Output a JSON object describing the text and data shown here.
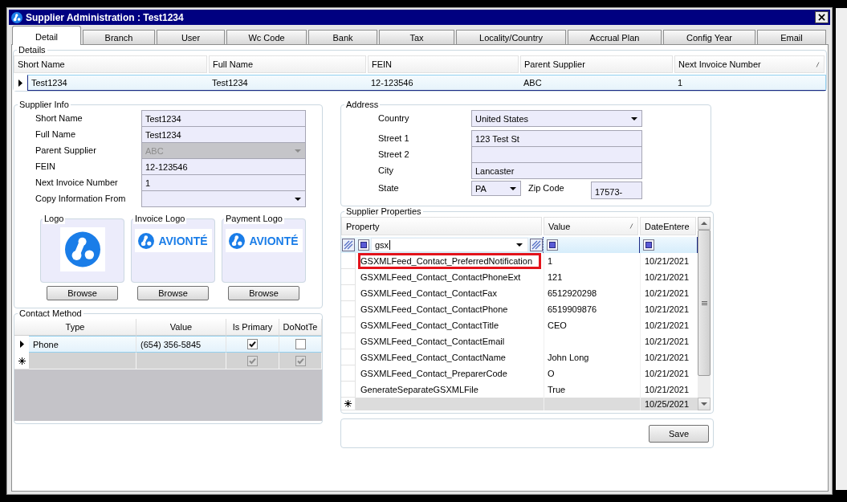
{
  "window": {
    "title": "Supplier Administration : Test1234"
  },
  "tabs": [
    {
      "label": "Detail",
      "selected": true
    },
    {
      "label": "Branch",
      "selected": false
    },
    {
      "label": "User",
      "selected": false
    },
    {
      "label": "Wc Code",
      "selected": false
    },
    {
      "label": "Bank",
      "selected": false
    },
    {
      "label": "Tax",
      "selected": false
    },
    {
      "label": "Locality/Country",
      "selected": false
    },
    {
      "label": "Accrual Plan",
      "selected": false
    },
    {
      "label": "Config Year",
      "selected": false
    },
    {
      "label": "Email",
      "selected": false
    }
  ],
  "details": {
    "title": "Details",
    "columns": [
      {
        "label": "Short Name",
        "sort_mark": false
      },
      {
        "label": "Full Name",
        "sort_mark": false
      },
      {
        "label": "FEIN",
        "sort_mark": false
      },
      {
        "label": "Parent Supplier",
        "sort_mark": false
      },
      {
        "label": "Next Invoice Number",
        "sort_mark": true
      }
    ],
    "rows": [
      {
        "current": true,
        "cells": [
          "Test1234",
          "Test1234",
          "12-123546",
          "ABC",
          "1"
        ]
      }
    ]
  },
  "supplier_info": {
    "title": "Supplier Info",
    "fields": [
      {
        "label": "Short Name",
        "kind": "text",
        "value": "Test1234",
        "disabled": false
      },
      {
        "label": "Full Name",
        "kind": "text",
        "value": "Test1234",
        "disabled": false
      },
      {
        "label": "Parent Supplier",
        "kind": "dropdown",
        "value": "ABC",
        "disabled": true
      },
      {
        "label": "FEIN",
        "kind": "text",
        "value": "12-123546",
        "disabled": false
      },
      {
        "label": "Next Invoice Number",
        "kind": "text",
        "value": "1",
        "disabled": false
      },
      {
        "label": "Copy Information From",
        "kind": "dropdown",
        "disabled": false
      }
    ],
    "logos": [
      {
        "title": "Logo",
        "kind": "mark",
        "button": "Browse"
      },
      {
        "title": "Invoice Logo",
        "kind": "wordmark",
        "wordmark": "AVIONTÉ",
        "button": "Browse"
      },
      {
        "title": "Payment Logo",
        "kind": "wordmark",
        "wordmark": "AVIONTÉ",
        "button": "Browse"
      }
    ]
  },
  "contact_method": {
    "title": "Contact Method",
    "columns": [
      "Type",
      "Value",
      "Is Primary",
      "DoNotTe"
    ],
    "rows": [
      {
        "kind": "data",
        "current": true,
        "cells": [
          {
            "kind": "text",
            "text": "Phone"
          },
          {
            "kind": "text",
            "text": "(654) 356-5845"
          },
          {
            "kind": "check",
            "checked": true
          },
          {
            "kind": "check",
            "checked": false
          }
        ]
      },
      {
        "kind": "new",
        "current": false,
        "cells": [
          {
            "kind": "blank"
          },
          {
            "kind": "blank"
          },
          {
            "kind": "check",
            "checked": true
          },
          {
            "kind": "check",
            "checked": true
          }
        ]
      }
    ]
  },
  "address": {
    "title": "Address",
    "fields": [
      {
        "label": "Country",
        "kind": "dropdown",
        "value": "United States"
      },
      {
        "label": "Street 1",
        "kind": "text",
        "value": "123 Test St"
      },
      {
        "label": "Street 2",
        "kind": "text"
      },
      {
        "label": "City",
        "kind": "text",
        "value": "Lancaster"
      },
      {
        "label": "State",
        "kind": "dropdown",
        "value": "PA",
        "extra": {
          "label": "Zip Code",
          "value": "17573-"
        }
      }
    ]
  },
  "supplier_properties": {
    "title": "Supplier Properties",
    "columns": [
      {
        "label": "Property",
        "sort_mark": false
      },
      {
        "label": "Value",
        "sort_mark": true
      },
      {
        "label": "DateEntere",
        "sort_mark": false
      }
    ],
    "filter": {
      "value": "gsx"
    },
    "rows": [
      {
        "property": "GSXMLFeed_Contact_PreferredNotification",
        "value": "1",
        "date": "10/21/2021",
        "highlighted": true
      },
      {
        "property": "GSXMLFeed_Contact_ContactPhoneExt",
        "value": "121",
        "date": "10/21/2021",
        "highlighted": false
      },
      {
        "property": "GSXMLFeed_Contact_ContactFax",
        "value": "6512920298",
        "date": "10/21/2021",
        "highlighted": false
      },
      {
        "property": "GSXMLFeed_Contact_ContactPhone",
        "value": "6519909876",
        "date": "10/21/2021",
        "highlighted": false
      },
      {
        "property": "GSXMLFeed_Contact_ContactTitle",
        "value": "CEO",
        "date": "10/21/2021",
        "highlighted": false
      },
      {
        "property": "GSXMLFeed_Contact_ContactEmail",
        "date": "10/21/2021",
        "highlighted": false
      },
      {
        "property": "GSXMLFeed_Contact_ContactName",
        "value": "John Long",
        "date": "10/21/2021",
        "highlighted": false
      },
      {
        "property": "GSXMLFeed_Contact_PreparerCode",
        "value": "O",
        "date": "10/21/2021",
        "highlighted": false
      },
      {
        "property": "GenerateSeparateGSXMLFile",
        "value": "True",
        "date": "10/21/2021",
        "highlighted": false
      }
    ],
    "new_row": {
      "date": "10/25/2021"
    }
  },
  "save_button": "Save"
}
